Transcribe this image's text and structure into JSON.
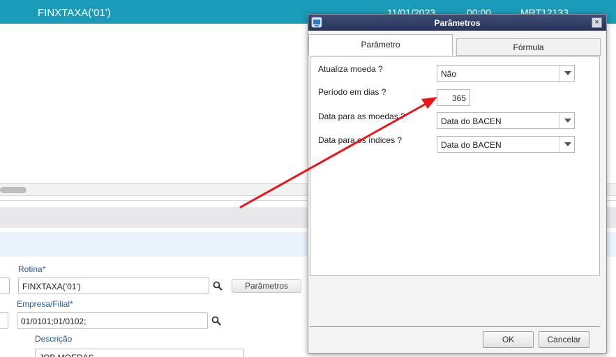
{
  "topbar": {
    "routine": "FINXTAXA('01')",
    "date": "11/01/2023",
    "time": "00:00",
    "code": "MRT12133"
  },
  "form": {
    "rotina_label": "Rotina*",
    "rotina_value": "FINXTAXA('01')",
    "parametros_button": "Parâmetros",
    "empresa_label": "Empresa/Filial*",
    "empresa_value": "01/0101;01/0102;",
    "descricao_label": "Descrição",
    "descricao_value": "JOB MOEDAS"
  },
  "dialog": {
    "title": "Parâmetros",
    "close_glyph": "×",
    "tabs": [
      {
        "label": "Parâmetro",
        "active": true
      },
      {
        "label": "Fórmula",
        "active": false
      }
    ],
    "fields": {
      "atualiza_label": "Atualiza moeda ?",
      "atualiza_value": "Não",
      "periodo_label": "Período em dias ?",
      "periodo_value": "365",
      "data_moedas_label": "Data para as moedas ?",
      "data_moedas_value": "Data do BACEN",
      "data_indices_label": "Data para os índices ?",
      "data_indices_value": "Data do BACEN"
    },
    "ok_label": "OK",
    "cancel_label": "Cancelar"
  },
  "colors": {
    "topbar": "#1a9bb9",
    "dialog_title": "#2f3b63",
    "annotation_arrow": "#e8151b"
  },
  "icons": [
    "search-icon",
    "window-icon",
    "close-icon",
    "chevron-down-icon"
  ]
}
